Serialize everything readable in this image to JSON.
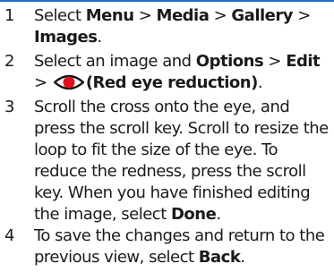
{
  "steps": [
    {
      "number": "1",
      "parts": {
        "t0": "Select ",
        "menu": "Menu",
        "sep1": " > ",
        "media": "Media",
        "sep2": " > ",
        "gallery": "Gallery",
        "sep3": " > ",
        "images": "Images",
        "end": "."
      }
    },
    {
      "number": "2",
      "parts": {
        "t0": "Select an image and ",
        "options": "Options",
        "sep1": " > ",
        "edit": "Edit",
        "sep2": " > ",
        "red_eye": "(Red eye reduction)",
        "end": "."
      },
      "icon": "red-eye-icon"
    },
    {
      "number": "3",
      "parts": {
        "t0": "Scroll the cross onto the eye, and press the scroll key. Scroll to resize the loop to fit the size of the eye. To reduce the redness, press the scroll key. When you have finished editing the image, select ",
        "done": "Done",
        "end": "."
      }
    },
    {
      "number": "4",
      "parts": {
        "t0": "To save the changes and return to the previous view, select ",
        "back": "Back",
        "end": "."
      }
    }
  ],
  "colors": {
    "rule": "#2a6db5",
    "eye_red": "#e0101a",
    "eye_outline": "#111111"
  }
}
